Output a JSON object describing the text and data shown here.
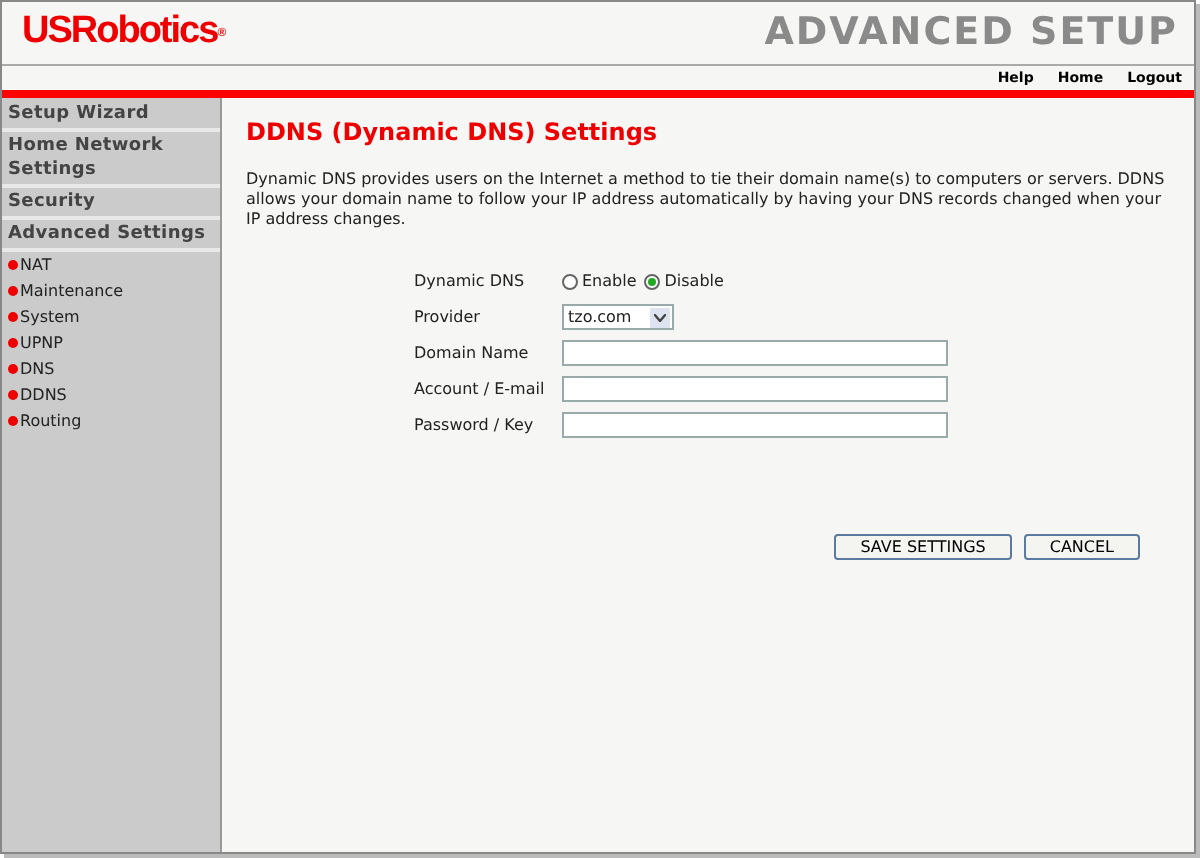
{
  "header": {
    "logo": "USRobotics",
    "logo_mark": "®",
    "title": "ADVANCED SETUP",
    "links": [
      "Help",
      "Home",
      "Logout"
    ]
  },
  "sidebar": {
    "items": [
      {
        "kind": "heading",
        "label": "Setup Wizard"
      },
      {
        "kind": "heading",
        "label": "Home Network Settings"
      },
      {
        "kind": "heading",
        "label": "Security"
      },
      {
        "kind": "heading",
        "label": "Advanced Settings"
      },
      {
        "kind": "link",
        "label": "NAT"
      },
      {
        "kind": "link",
        "label": "Maintenance"
      },
      {
        "kind": "link",
        "label": "System"
      },
      {
        "kind": "link",
        "label": "UPNP"
      },
      {
        "kind": "link",
        "label": "DNS"
      },
      {
        "kind": "link",
        "label": "DDNS"
      },
      {
        "kind": "link",
        "label": "Routing"
      }
    ]
  },
  "page": {
    "title": "DDNS (Dynamic DNS) Settings",
    "description": "Dynamic DNS provides users on the Internet a method to tie their domain name(s) to computers or servers. DDNS allows your domain name to follow your IP address automatically by having your DNS records changed when your IP address changes."
  },
  "form": [
    {
      "kind": "radio",
      "label": "Dynamic DNS",
      "options": [
        {
          "label": "Enable",
          "selected": false
        },
        {
          "label": "Disable",
          "selected": true
        }
      ]
    },
    {
      "kind": "select",
      "label": "Provider",
      "value": "tzo.com"
    },
    {
      "kind": "text",
      "label": "Domain Name"
    },
    {
      "kind": "text",
      "label": "Account / E-mail"
    },
    {
      "kind": "password",
      "label": "Password / Key"
    }
  ],
  "buttons": [
    "SAVE SETTINGS",
    "CANCEL"
  ]
}
